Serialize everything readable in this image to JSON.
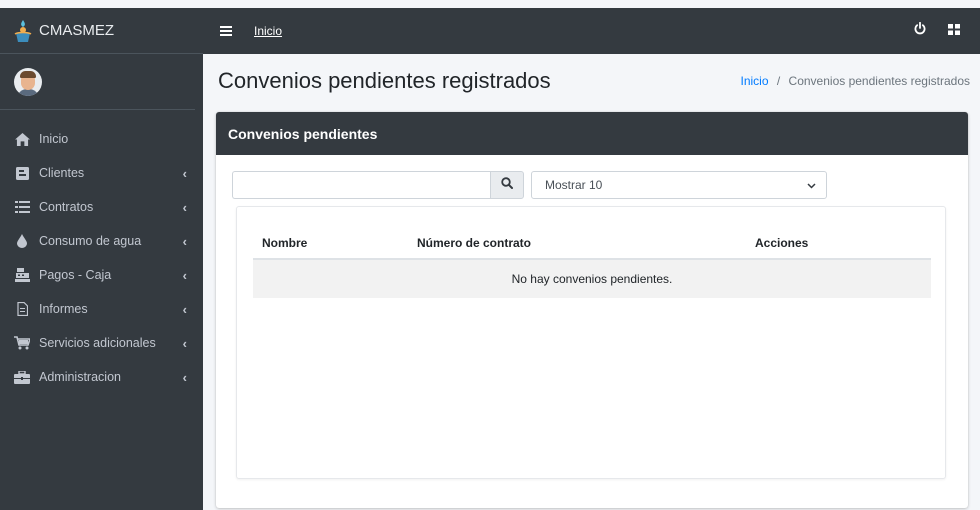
{
  "app": {
    "brand": "CMASMEZ"
  },
  "topbar": {
    "link": "Inicio",
    "icons": [
      "power-icon",
      "grid-icon"
    ]
  },
  "sidebar": {
    "items": [
      {
        "label": "Inicio",
        "icon": "home-icon",
        "has_submenu": false
      },
      {
        "label": "Clientes",
        "icon": "id-card-icon",
        "has_submenu": true
      },
      {
        "label": "Contratos",
        "icon": "list-icon",
        "has_submenu": true
      },
      {
        "label": "Consumo de agua",
        "icon": "water-drop-icon",
        "has_submenu": true
      },
      {
        "label": "Pagos - Caja",
        "icon": "cash-register-icon",
        "has_submenu": true
      },
      {
        "label": "Informes",
        "icon": "file-icon",
        "has_submenu": true
      },
      {
        "label": "Servicios adicionales",
        "icon": "cart-icon",
        "has_submenu": true
      },
      {
        "label": "Administracion",
        "icon": "toolbox-icon",
        "has_submenu": true
      }
    ],
    "chevron": "‹"
  },
  "page": {
    "title": "Convenios pendientes registrados",
    "breadcrumb": {
      "home": "Inicio",
      "separator": "/",
      "current": "Convenios pendientes registrados"
    }
  },
  "card": {
    "title": "Convenios pendientes",
    "search": {
      "value": "",
      "placeholder": ""
    },
    "page_size": {
      "selected": "Mostrar 10"
    },
    "table": {
      "columns": [
        "Nombre",
        "Número de contrato",
        "Acciones"
      ],
      "empty_message": "No hay convenios pendientes."
    }
  },
  "colors": {
    "dark": "#343a40",
    "accent": "#007bff",
    "sidebar_text": "#c2c7d0",
    "background": "#f4f6f9"
  }
}
